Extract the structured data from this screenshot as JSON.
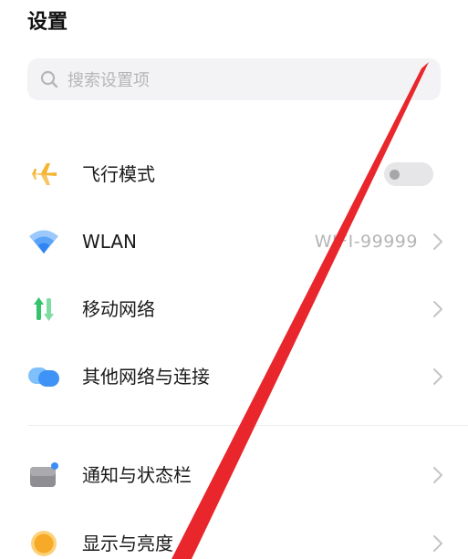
{
  "header": {
    "title": "设置"
  },
  "search": {
    "placeholder": "搜索设置项",
    "icon": "search-icon"
  },
  "settings": {
    "airplane": {
      "label": "飞行模式",
      "icon": "airplane-icon",
      "toggle_on": false
    },
    "wlan": {
      "label": "WLAN",
      "value": "WIFI-99999",
      "icon": "wifi-icon"
    },
    "mobile": {
      "label": "移动网络",
      "icon": "mobile-data-icon"
    },
    "other": {
      "label": "其他网络与连接",
      "icon": "cloud-connection-icon"
    },
    "notify": {
      "label": "通知与状态栏",
      "icon": "notification-icon"
    },
    "display": {
      "label": "显示与亮度",
      "icon": "brightness-icon"
    }
  },
  "colors": {
    "accent_red": "#e8262b",
    "airplane": "#f5b433",
    "wifi": "#3a8ef6",
    "mobile_green": "#34c26b",
    "cloud_blue": "#3f93f7",
    "display_orange": "#f7a928"
  }
}
